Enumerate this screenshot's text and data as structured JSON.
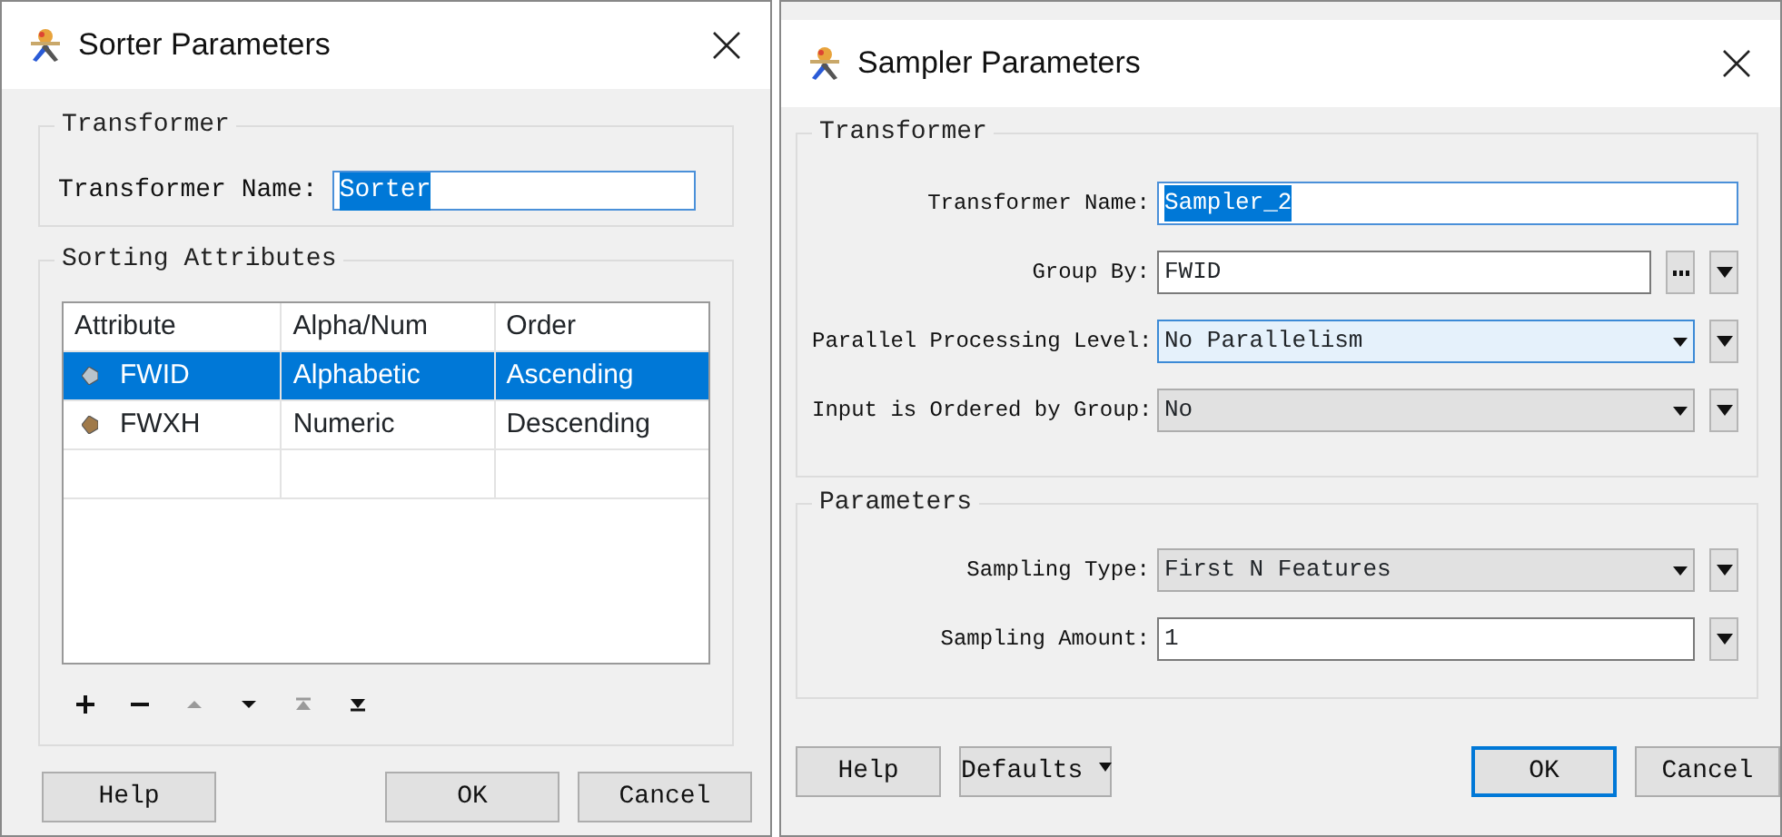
{
  "sorter_dialog": {
    "title": "Sorter Parameters",
    "transformer_group": {
      "legend": "Transformer",
      "name_label": "Transformer Name:",
      "name_value": "Sorter",
      "name_highlighted": true
    },
    "sorting_group": {
      "legend": "Sorting Attributes",
      "columns": [
        "Attribute",
        "Alpha/Num",
        "Order"
      ],
      "rows": [
        {
          "attribute": "FWID",
          "alpha_num": "Alphabetic",
          "order": "Ascending",
          "selected": true
        },
        {
          "attribute": "FWXH",
          "alpha_num": "Numeric",
          "order": "Descending",
          "selected": false
        }
      ],
      "toolbar": [
        {
          "kind": "add",
          "disabled": false
        },
        {
          "kind": "remove",
          "disabled": false
        },
        {
          "kind": "up",
          "disabled": true
        },
        {
          "kind": "down",
          "disabled": false
        },
        {
          "kind": "top",
          "disabled": true
        },
        {
          "kind": "bottom",
          "disabled": false
        }
      ]
    },
    "buttons": [
      {
        "label": "Help",
        "default": false
      },
      {
        "label": "OK",
        "default": false
      },
      {
        "label": "Cancel",
        "default": false
      }
    ]
  },
  "sampler_dialog": {
    "title": "Sampler Parameters",
    "groups": [
      {
        "legend": "Transformer",
        "fields": [
          {
            "label": "Transformer Name:",
            "value": "Sampler_2",
            "kind": "text",
            "highlighted": true,
            "focused": false,
            "browse": false,
            "menu": false
          },
          {
            "label": "Group By:",
            "value": "FWID",
            "kind": "text",
            "highlighted": false,
            "focused": false,
            "browse": true,
            "menu": true
          },
          {
            "label": "Parallel Processing Level:",
            "value": "No Parallelism",
            "kind": "combo",
            "highlighted": false,
            "focused": true,
            "browse": false,
            "menu": true
          },
          {
            "label": "Input is Ordered by Group:",
            "value": "No",
            "kind": "combo",
            "highlighted": false,
            "focused": false,
            "browse": false,
            "menu": true
          }
        ]
      },
      {
        "legend": "Parameters",
        "fields": [
          {
            "label": "Sampling Type:",
            "value": "First N Features",
            "kind": "combo",
            "highlighted": false,
            "focused": false,
            "browse": false,
            "menu": true
          },
          {
            "label": "Sampling Amount:",
            "value": "1",
            "kind": "text",
            "highlighted": false,
            "focused": false,
            "browse": false,
            "menu": true
          }
        ]
      }
    ],
    "buttons": [
      {
        "label": "Help",
        "menu": false,
        "default": false
      },
      {
        "label": "Defaults",
        "menu": true,
        "default": false
      },
      {
        "label": "OK",
        "menu": false,
        "default": true
      },
      {
        "label": "Cancel",
        "menu": false,
        "default": false
      }
    ]
  }
}
